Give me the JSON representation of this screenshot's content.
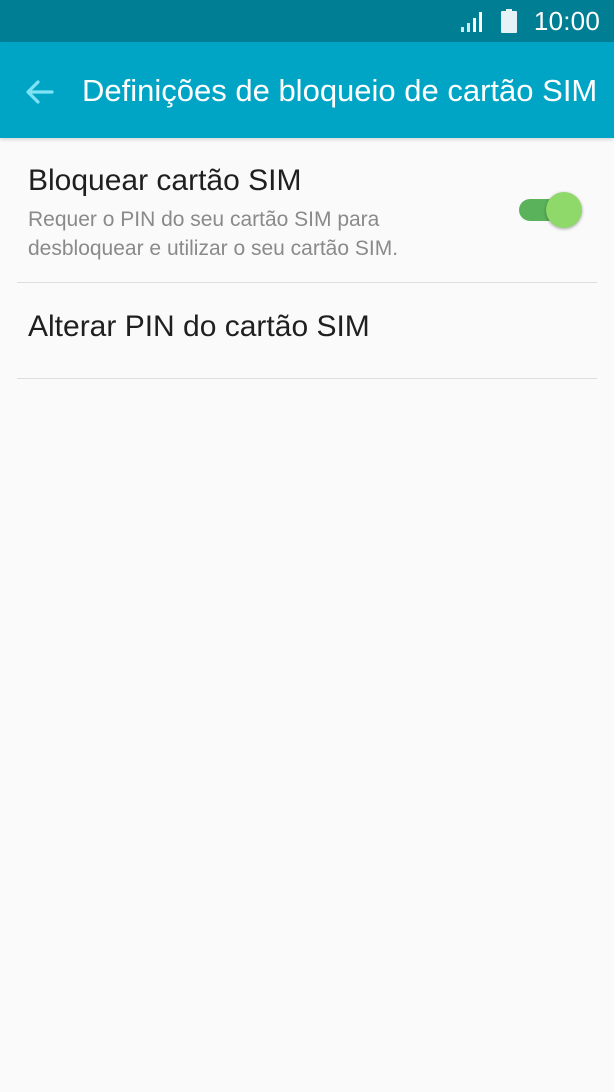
{
  "status_bar": {
    "time": "10:00",
    "signal_icon": "signal-icon",
    "battery_icon": "battery-icon",
    "background": "#007e93"
  },
  "app_bar": {
    "back_icon": "arrow-back-icon",
    "title": "Definições de bloqueio de cartão SIM",
    "background": "#00a5c5",
    "accent": "#7fe3f5"
  },
  "settings": {
    "lock_sim": {
      "title": "Bloquear cartão SIM",
      "summary": "Requer o PIN do seu cartão SIM para desbloquear e utilizar o seu cartão SIM.",
      "enabled": true,
      "toggle_color": "#8fd96a"
    },
    "change_pin": {
      "title": "Alterar PIN do cartão SIM"
    }
  }
}
